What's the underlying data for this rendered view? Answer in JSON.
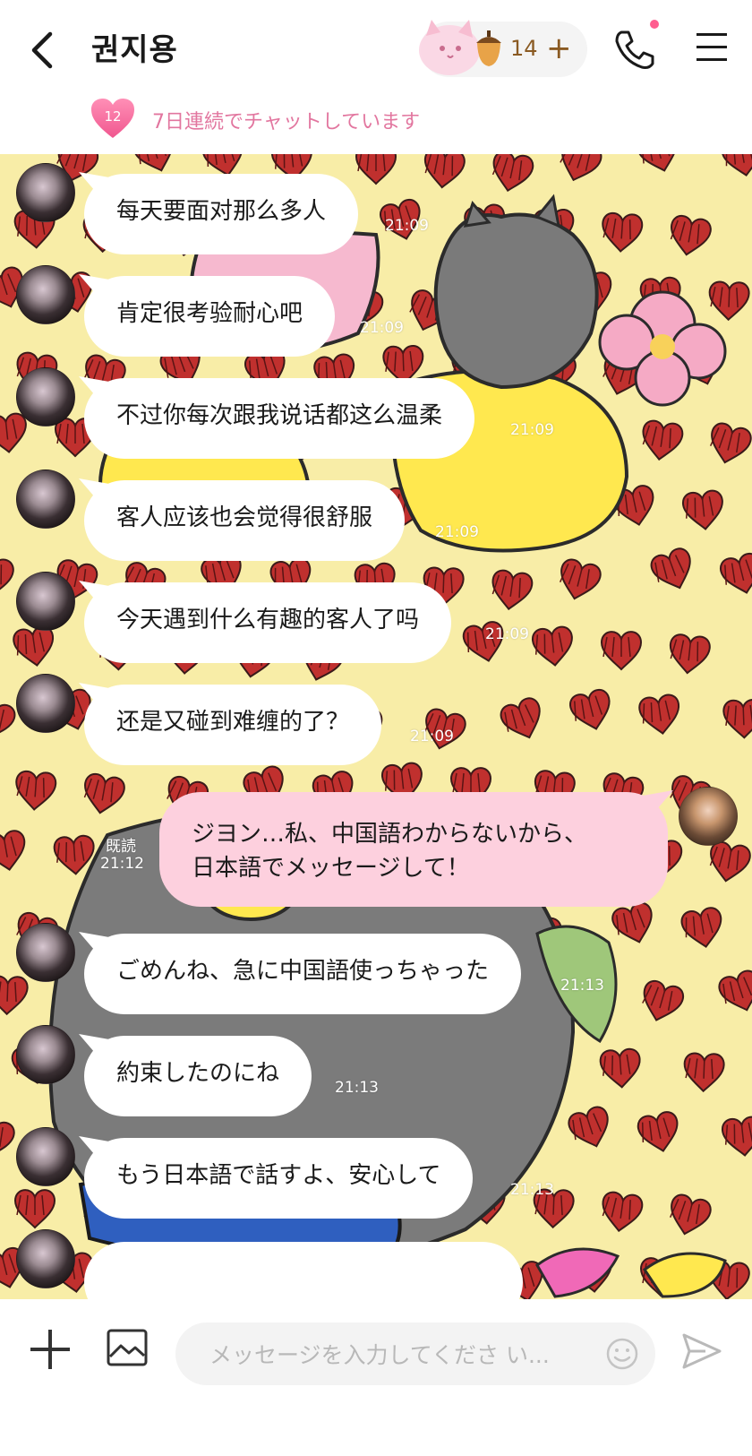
{
  "header": {
    "contact_name": "권지용",
    "acorn_count": "14",
    "streak_days": "12",
    "streak_text": "7日連続でチャットしています"
  },
  "messages": [
    {
      "from": "them",
      "text": "每天要面对那么多人",
      "time": "21:09"
    },
    {
      "from": "them",
      "text": "肯定很考验耐心吧",
      "time": "21:09"
    },
    {
      "from": "them",
      "text": "不过你每次跟我说话都这么温柔",
      "time": "21:09"
    },
    {
      "from": "them",
      "text": "客人应该也会觉得很舒服",
      "time": "21:09"
    },
    {
      "from": "them",
      "text": "今天遇到什么有趣的客人了吗",
      "time": "21:09"
    },
    {
      "from": "them",
      "text": "还是又碰到难缠的了？",
      "time": "21:09"
    },
    {
      "from": "me",
      "line1": "ジヨン…私、中国語わからないから、",
      "line2": "日本語でメッセージして！",
      "read": "既読",
      "time": "21:12"
    },
    {
      "from": "them",
      "text": "ごめんね、急に中国語使っちゃった",
      "time": "21:13"
    },
    {
      "from": "them",
      "text": "約束したのにね",
      "time": "21:13"
    },
    {
      "from": "them",
      "text": "もう日本語で話すよ、安心して",
      "time": "21:13"
    }
  ],
  "input": {
    "placeholder": "メッセージを入力してくださ い..."
  },
  "colors": {
    "chat_background": "#f8eda7",
    "heart": "#c0302e",
    "my_bubble": "#fdd0de",
    "their_bubble": "#ffffff",
    "streak_text": "#e2769f"
  }
}
